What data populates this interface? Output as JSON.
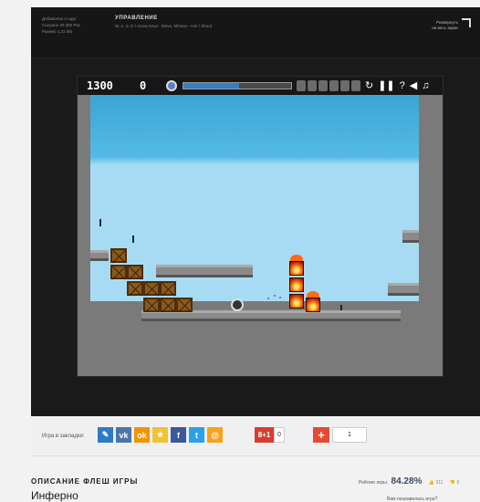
{
  "info": {
    "meta_lines": [
      "Добавлена 4 года",
      "Сыграно 30 300 Раз",
      "Размер 1,31 Mb"
    ],
    "controls_title": "УПРАВЛЕНИЕ",
    "controls_text": "W, A, S, D / Arrow Keys - Move, MOuse - Aim / Shoot",
    "expand_label": [
      "Развернуть",
      "на весь экран"
    ]
  },
  "hud": {
    "score": "1300",
    "second_value": "0",
    "health_fraction": 0.52,
    "controls": [
      "↻",
      "❚❚",
      "?",
      "◀",
      "♫"
    ]
  },
  "share": {
    "label": "Игра в закладки:",
    "buttons": [
      {
        "icon": "bookmark-icon",
        "glyph": "✎",
        "color": "#2a7cc4"
      },
      {
        "icon": "vk-icon",
        "glyph": "vk",
        "color": "#4a76a8"
      },
      {
        "icon": "odnoklassniki-icon",
        "glyph": "ok",
        "color": "#f29400"
      },
      {
        "icon": "star-icon",
        "glyph": "★",
        "color": "#f2c231"
      },
      {
        "icon": "facebook-icon",
        "glyph": "f",
        "color": "#3b5998"
      },
      {
        "icon": "twitter-icon",
        "glyph": "t",
        "color": "#2ba1e8"
      },
      {
        "icon": "mailru-icon",
        "glyph": "@",
        "color": "#f7a21b"
      }
    ],
    "gplus_label": "8+1",
    "gplus_count": "0",
    "plus_glyph": "+",
    "plus_count": "1"
  },
  "description": {
    "title": "ОПИСАНИЕ ФЛЕШ ИГРЫ",
    "name": "Инферно"
  },
  "rating": {
    "label": "Рейтинг игры:",
    "value": "84.28%",
    "likes": "311",
    "dislikes": "5",
    "question": "Вам понравилась игра?"
  }
}
